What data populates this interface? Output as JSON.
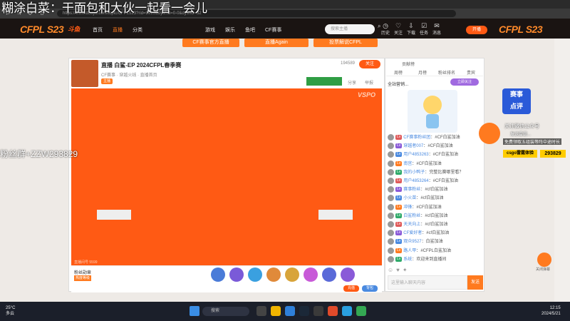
{
  "overlay": {
    "title": "糊涂白菜：干面包和大伙一起看一会儿",
    "side_text": "粉丝群+ZZW293829",
    "right_line1": "关注微信公众号",
    "right_line2": "发送雷霆...",
    "right_line3": "免费领取五组装等阵中途时长",
    "right_button": "csgo雷霆体验",
    "right_number": "293829"
  },
  "browser": {
    "url": "https://www.douyu.com/topic/CFPL523?rid=9999&dyshid=0-0&dyshci=32",
    "back": "←",
    "forward": "→",
    "reload": "⟳",
    "home": "⌂"
  },
  "header": {
    "logo": "CFPL S23",
    "site_logo": "斗鱼",
    "nav": [
      "首页",
      "直播",
      "分类",
      "游戏",
      "娱乐",
      "鱼吧",
      "CF赛事"
    ],
    "search_placeholder": "搜索主播",
    "icons": [
      "历史",
      "关注",
      "下载",
      "任务",
      "消息",
      "开播"
    ],
    "login": "开播"
  },
  "page": {
    "banner_buttons": [
      "CF赛事官方直播",
      "直播Again",
      "投票解说CFPL"
    ]
  },
  "stream": {
    "title": "直播 白鲨-EP 2024CFPL春季赛",
    "subtitle": "CF赛事 · 穿越火线 · 直播首页",
    "tag": "主播",
    "follow": "关注",
    "heat": "194589",
    "share": "分享",
    "report": "举报",
    "watermark": "VSPO",
    "bottom_left": "直播间号 5599"
  },
  "gift_bar": {
    "fan_label": "粉丝勋章",
    "fan_sub": "热度等级",
    "recharge": "充值",
    "backpack": "背包"
  },
  "chat": {
    "header": "贡献榜",
    "tabs": [
      "周榜",
      "月榜",
      "粉丝排名",
      "贵宾"
    ],
    "announce": "全站营销...",
    "announce_btn": "立即关注",
    "messages": [
      {
        "user": "CF赛事粉丝团",
        "text": "#CF白鲨加油"
      },
      {
        "user": "穿越者007",
        "text": "#CF白鲨加油"
      },
      {
        "user": "用户4853263",
        "text": "#CF白鲨加油"
      },
      {
        "user": "南宫",
        "text": "#CF白鲨加油"
      },
      {
        "user": "我的小鸭子",
        "text": "完整比赛哪里看？"
      },
      {
        "user": "用户4853264",
        "text": "#CF白鲨加油"
      },
      {
        "user": "赛事粉丝",
        "text": "#cf白鲨加油"
      },
      {
        "user": "小火苗",
        "text": "#cf白鲨加油"
      },
      {
        "user": "冲锋",
        "text": "#CF白鲨加油"
      },
      {
        "user": "白鲨粉丝",
        "text": "#cf白鲨加油"
      },
      {
        "user": "天天向上",
        "text": "#cf白鲨加油"
      },
      {
        "user": "CF爱好者",
        "text": "#cf白鲨加油"
      },
      {
        "user": "观众9527",
        "text": "白鲨加油"
      },
      {
        "user": "路人甲",
        "text": "#CFPL白鲨加油"
      },
      {
        "user": "系统",
        "text": "欢迎来到直播间"
      }
    ],
    "input_placeholder": "这里输入聊天内容",
    "send": "发送"
  },
  "float_btn": "关闭弹幕",
  "taskbar": {
    "temp": "25°C",
    "weather": "多云",
    "search": "搜索",
    "time": "12:15",
    "date": "2024/5/21"
  },
  "colors": {
    "accent": "#ff7a1f",
    "player": "#ff5a14"
  }
}
